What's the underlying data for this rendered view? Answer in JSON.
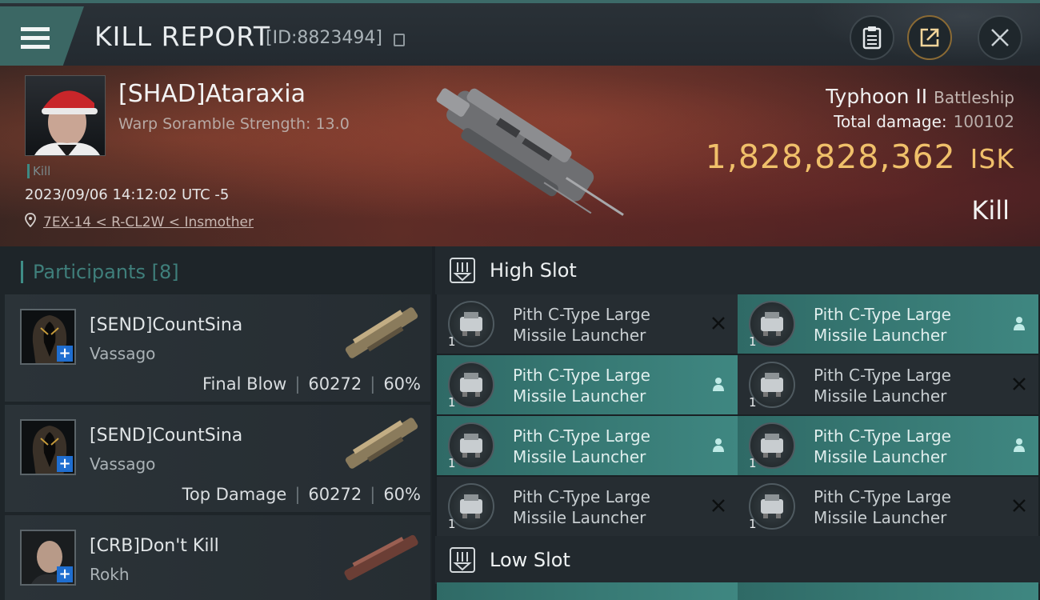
{
  "header": {
    "title": "KILL REPORT",
    "report_id": "[ID:8823494]"
  },
  "victim": {
    "name": "[SHAD]Ataraxia",
    "subtitle": "Warp Soramble Strength: 13.0",
    "tag": "Kill",
    "datetime": "2023/09/06 14:12:02 UTC -5",
    "location": "7EX-14 < R-CL2W < Insmother",
    "ship_name": "Typhoon II",
    "ship_class": "Battleship",
    "total_damage_label": "Total damage:",
    "total_damage": "100102",
    "isk_value": "1,828,828,362",
    "isk_unit": "ISK",
    "result": "Kill"
  },
  "participants": {
    "title": "Participants [8]",
    "rows": [
      {
        "name": "[SEND]CountSina",
        "ship": "Vassago",
        "role": "Final Blow",
        "damage": "60272",
        "percent": "60%"
      },
      {
        "name": "[SEND]CountSina",
        "ship": "Vassago",
        "role": "Top Damage",
        "damage": "60272",
        "percent": "60%"
      },
      {
        "name": "[CRB]Don't Kill",
        "ship": "Rokh",
        "role": "",
        "damage": "",
        "percent": ""
      }
    ]
  },
  "slots": {
    "high_label": "High Slot",
    "low_label": "Low Slot",
    "high_modules": [
      {
        "line1": "Pith C-Type Large",
        "line2": "Missile Launcher",
        "count": "1",
        "state": "destroyed"
      },
      {
        "line1": "Pith C-Type Large",
        "line2": "Missile Launcher",
        "count": "1",
        "state": "dropped"
      },
      {
        "line1": "Pith C-Type Large",
        "line2": "Missile Launcher",
        "count": "1",
        "state": "dropped"
      },
      {
        "line1": "Pith C-Type Large",
        "line2": "Missile Launcher",
        "count": "1",
        "state": "destroyed"
      },
      {
        "line1": "Pith C-Type Large",
        "line2": "Missile Launcher",
        "count": "1",
        "state": "dropped"
      },
      {
        "line1": "Pith C-Type Large",
        "line2": "Missile Launcher",
        "count": "1",
        "state": "dropped"
      },
      {
        "line1": "Pith C-Type Large",
        "line2": "Missile Launcher",
        "count": "1",
        "state": "destroyed"
      },
      {
        "line1": "Pith C-Type Large",
        "line2": "Missile Launcher",
        "count": "1",
        "state": "destroyed"
      }
    ]
  },
  "icons": {
    "menu": "hamburger-icon",
    "copy": "copy-icon",
    "clipboard": "clipboard-icon",
    "share": "share-icon",
    "close": "close-icon",
    "location": "location-pin-icon",
    "slot": "high-slot-icon",
    "dropped": "person-icon",
    "destroyed": "x-icon"
  },
  "colors": {
    "accent_teal": "#3f8781",
    "isk_gold": "#f0c06a",
    "banner_red": "#5a2e26"
  }
}
